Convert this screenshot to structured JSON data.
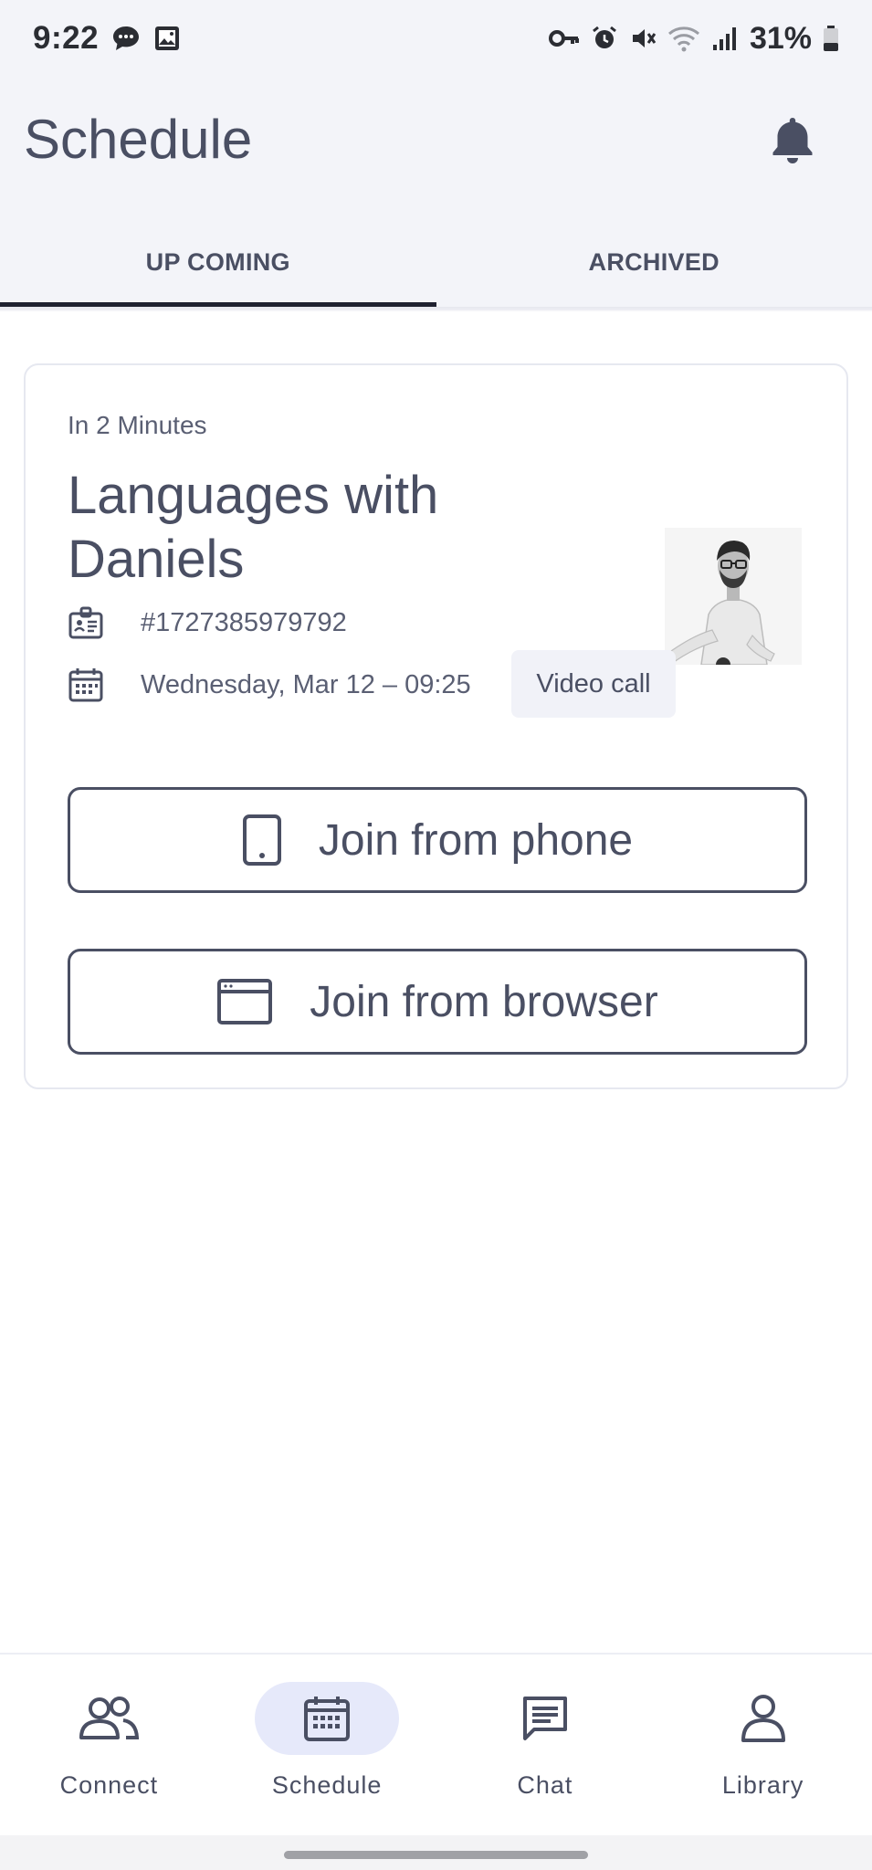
{
  "status_bar": {
    "time": "9:22",
    "battery_percent": "31%",
    "left_icons": [
      "chat-bubble-icon",
      "image-icon"
    ],
    "right_icons": [
      "key-icon",
      "alarm-icon",
      "mute-icon",
      "wifi-icon",
      "signal-icon",
      "battery-icon"
    ]
  },
  "header": {
    "title": "Schedule",
    "bell_icon": "bell-icon"
  },
  "tabs": [
    {
      "label": "UP COMING",
      "active": true
    },
    {
      "label": "ARCHIVED",
      "active": false
    }
  ],
  "card": {
    "eta": "In 2 Minutes",
    "title": "Languages with Daniels",
    "id": "#1727385979792",
    "datetime": "Wednesday, Mar 12 – 09:25",
    "call_type": "Video call",
    "join_phone_label": "Join from phone",
    "join_browser_label": "Join from browser"
  },
  "nav": [
    {
      "label": "Connect",
      "icon": "people-icon",
      "active": false
    },
    {
      "label": "Schedule",
      "icon": "calendar-icon",
      "active": true
    },
    {
      "label": "Chat",
      "icon": "chat-icon",
      "active": false
    },
    {
      "label": "Library",
      "icon": "person-icon",
      "active": false
    }
  ],
  "colors": {
    "text": "#4a4f63",
    "header_bg": "#f3f4f9",
    "active_pill": "#e6e9fa",
    "tab_indicator": "#1f2130"
  }
}
